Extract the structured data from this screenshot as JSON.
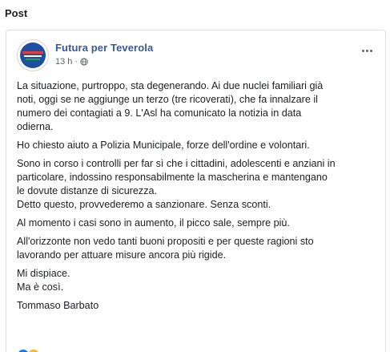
{
  "section_title": "Post",
  "post": {
    "page_name": "Futura per Teverola",
    "timestamp": "13 h",
    "separator": "·",
    "privacy_icon": "globe-icon",
    "more_icon": "more-options-icon",
    "paragraphs": [
      "La situazione, purtroppo, sta degenerando. Ai due nuclei familiari già\nnoti, oggi se ne aggiunge un terzo (tre ricoverati), che fa innalzare il\nnumero dei contagiati a 9. L'Asl ha comunicato la notizia in data\nodierna.",
      "Ho chiesto aiuto a Polizia Municipale, forze dell'ordine e volontari.",
      "Sono in corso i controlli per far sì che i cittadini, adolescenti e anziani in\nparticolare, indossino responsabilmente la mascherina e mantengano\nle dovute distanze di sicurezza.\nDetto questo, provvederemo a sanzionare. Senza sconti.",
      "Al momento i casi sono in aumento, il picco sale, sempre più.",
      "All'orizzonte non vedo tanti buoni propositi e per queste ragioni sto\nlavorando per attuare misure ancora più rigide.",
      "Mi dispiace.\nMa è così.",
      "Tommaso Barbato"
    ],
    "reactions": [
      "like",
      "haha"
    ]
  },
  "colors": {
    "page_name": "#385898",
    "meta_text": "#606770",
    "card_border": "#dddfe2",
    "like": "#1877f2",
    "haha": "#f7b928"
  }
}
